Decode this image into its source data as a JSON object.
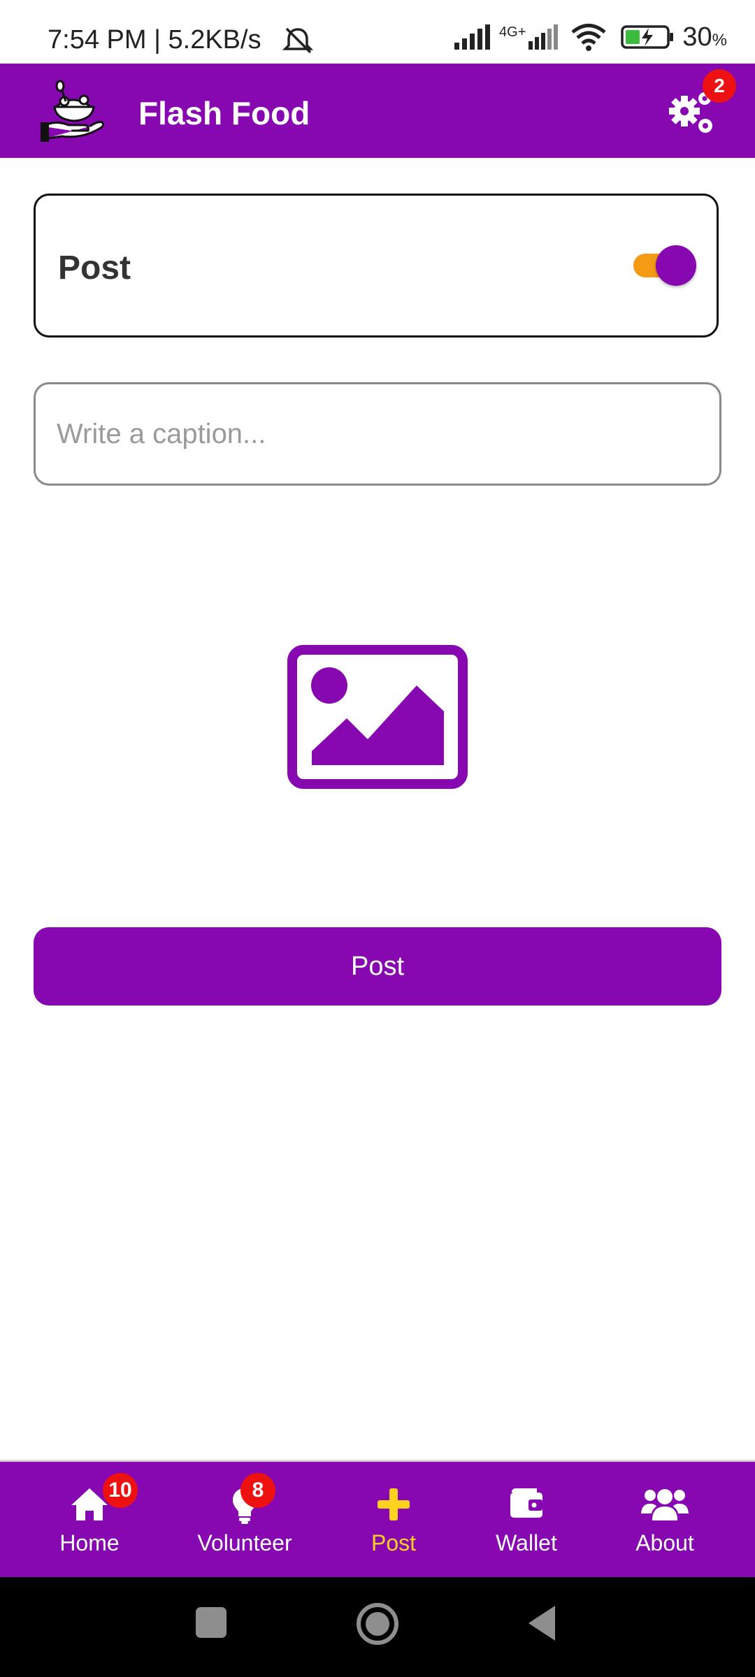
{
  "status_bar": {
    "time": "7:54 PM | 5.2KB/s",
    "network": "4G+",
    "battery_percent": "30",
    "battery_unit": "%"
  },
  "app_bar": {
    "title": "Flash Food",
    "settings_badge": "2",
    "icons": [
      "food-donation-logo-icon",
      "settings-gears-icon"
    ]
  },
  "post_card": {
    "label": "Post",
    "toggle_on": true
  },
  "caption": {
    "placeholder": "Write a caption...",
    "value": ""
  },
  "image_picker": {
    "icon": "image-placeholder-icon"
  },
  "post_button": {
    "label": "Post"
  },
  "bottom_nav": {
    "items": [
      {
        "label": "Home",
        "badge": "10",
        "icon": "home-icon"
      },
      {
        "label": "Volunteer",
        "badge": "8",
        "icon": "volunteer-icon"
      },
      {
        "label": "Post",
        "active": true,
        "icon": "plus-icon"
      },
      {
        "label": "Wallet",
        "icon": "wallet-icon"
      },
      {
        "label": "About",
        "icon": "users-icon"
      }
    ]
  },
  "colors": {
    "primary": "#8708b0",
    "active_nav": "#ffd21f",
    "toggle_track": "#f59a14",
    "badge": "#ee1111"
  }
}
